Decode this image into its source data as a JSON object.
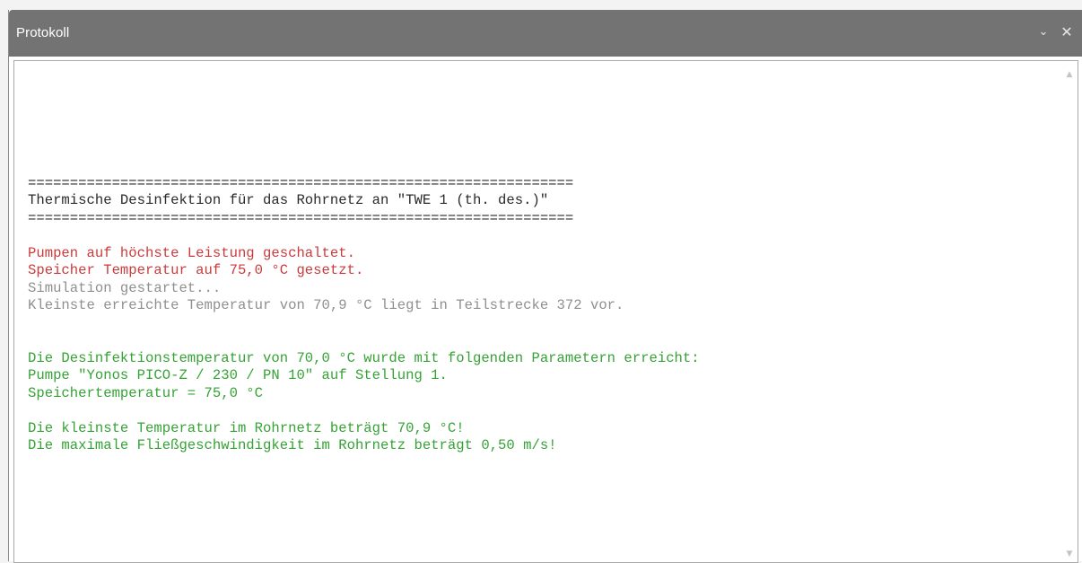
{
  "window": {
    "title": "Protokoll",
    "menu_glyph": "⌄",
    "close_glyph": "✕"
  },
  "log": [
    {
      "text": "",
      "color": "black"
    },
    {
      "text": "",
      "color": "black"
    },
    {
      "text": "",
      "color": "black"
    },
    {
      "text": "=================================================================",
      "color": "black"
    },
    {
      "text": "Thermische Desinfektion für das Rohrnetz an \"TWE 1 (th. des.)\"",
      "color": "black"
    },
    {
      "text": "=================================================================",
      "color": "black"
    },
    {
      "text": "",
      "color": "black"
    },
    {
      "text": "Pumpen auf höchste Leistung geschaltet.",
      "color": "red"
    },
    {
      "text": "Speicher Temperatur auf 75,0 °C gesetzt.",
      "color": "red"
    },
    {
      "text": "Simulation gestartet...",
      "color": "gray"
    },
    {
      "text": "Kleinste erreichte Temperatur von 70,9 °C liegt in Teilstrecke 372 vor.",
      "color": "gray"
    },
    {
      "text": "",
      "color": "black"
    },
    {
      "text": "",
      "color": "black"
    },
    {
      "text": "Die Desinfektionstemperatur von 70,0 °C wurde mit folgenden Parametern erreicht:",
      "color": "green"
    },
    {
      "text": "Pumpe \"Yonos PICO-Z / 230 / PN 10\" auf Stellung 1.",
      "color": "green"
    },
    {
      "text": "Speichertemperatur = 75,0 °C",
      "color": "green"
    },
    {
      "text": "",
      "color": "black"
    },
    {
      "text": "Die kleinste Temperatur im Rohrnetz beträgt 70,9 °C!",
      "color": "green"
    },
    {
      "text": "Die maximale Fließgeschwindigkeit im Rohrnetz beträgt 0,50 m/s!",
      "color": "green"
    }
  ],
  "scrollbar": {
    "up_glyph": "▲",
    "down_glyph": "▼"
  },
  "colors": {
    "titlebar": "#737373",
    "black": "#2a2a2a",
    "red": "#cc3b3b",
    "gray": "#8f8f8f",
    "green": "#35a335"
  }
}
